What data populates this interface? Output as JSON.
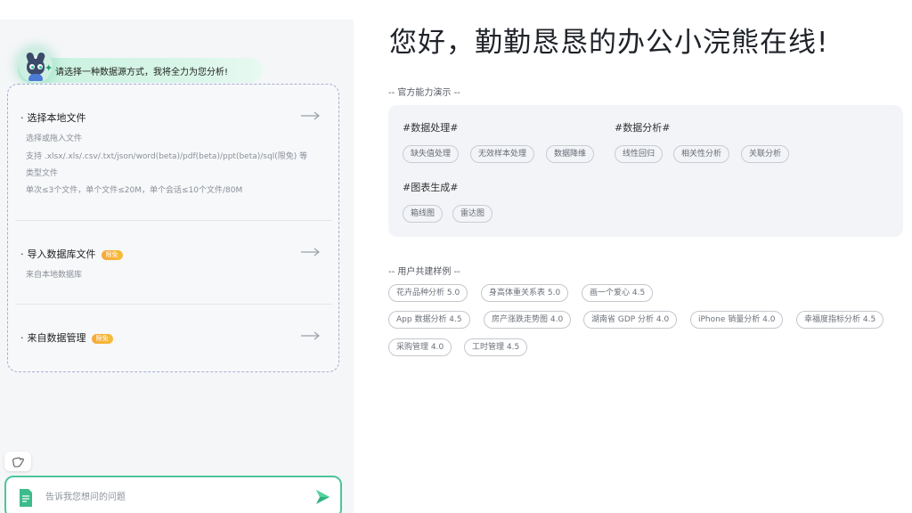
{
  "left": {
    "greeting": "请选择一种数据源方式，我将全力为您分析!",
    "options": [
      {
        "title": "选择本地文件",
        "desc": [
          "选择或拖入文件",
          "支持 .xlsx/.xls/.csv/.txt/json/word(beta)/pdf(beta)/ppt(beta)/sql(限免) 等",
          "类型文件",
          "单次≤3个文件，单个文件≤20M，单个会话≤10个文件/80M"
        ]
      },
      {
        "title": "导入数据库文件",
        "badge": "限免",
        "desc": [
          "来自本地数据库"
        ]
      },
      {
        "title": "来自数据管理",
        "badge": "限免"
      }
    ],
    "input": {
      "placeholder": "告诉我您想问的问题"
    }
  },
  "right": {
    "title": "您好，勤勤恳恳的办公小浣熊在线!",
    "capabilities_label": "-- 官方能力演示 --",
    "groups": [
      {
        "title": "#数据处理#",
        "chips": [
          "缺失值处理",
          "无效样本处理",
          "数据降维"
        ]
      },
      {
        "title": "#数据分析#",
        "chips": [
          "线性回归",
          "相关性分析",
          "关联分析"
        ]
      },
      {
        "title": "#图表生成#",
        "chips": [
          "箱线图",
          "雷达图"
        ]
      }
    ],
    "examples_label": "-- 用户共建样例 --",
    "examples": [
      "花卉品种分析 5.0",
      "身高体重关系表 5.0",
      "画一个爱心 4.5",
      "App 数据分析 4.5",
      "房产涨跌走势图 4.0",
      "湖南省 GDP 分析 4.0",
      "iPhone 销量分析 4.0",
      "幸福度指标分析 4.5",
      "采购管理 4.0",
      "工时管理 4.5"
    ]
  },
  "colors": {
    "accent": "#4cc59a",
    "badge": "#f5b03a",
    "dashed_border": "#a7acd4"
  },
  "icons": [
    "raccoon-avatar-icon",
    "sparkle-icon",
    "arrow-right-icon",
    "hand-icon",
    "document-icon",
    "send-icon"
  ]
}
